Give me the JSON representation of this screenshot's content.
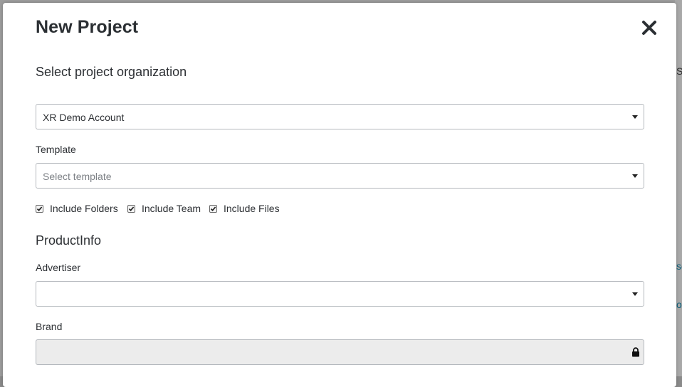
{
  "modal": {
    "title": "New Project",
    "close_icon": "close-icon"
  },
  "organization": {
    "heading": "Select project organization",
    "selected": "XR Demo Account"
  },
  "template": {
    "label": "Template",
    "placeholder": "Select template"
  },
  "options": [
    {
      "label": "Include Folders",
      "checked": true
    },
    {
      "label": "Include Team",
      "checked": true
    },
    {
      "label": "Include Files",
      "checked": true
    }
  ],
  "product_info": {
    "heading": "ProductInfo",
    "advertiser_label": "Advertiser",
    "advertiser_value": "",
    "brand_label": "Brand",
    "brand_value": "",
    "brand_icon": "lock-icon"
  },
  "background": {
    "fragment_1": "S",
    "fragment_2": "se",
    "fragment_3": "ol"
  },
  "colors": {
    "overlay": "#9c9c9c",
    "modal_bg": "#ffffff",
    "input_border": "#b4b8bd",
    "locked_bg": "#ececec",
    "link_fragment": "#0c5f7a"
  }
}
